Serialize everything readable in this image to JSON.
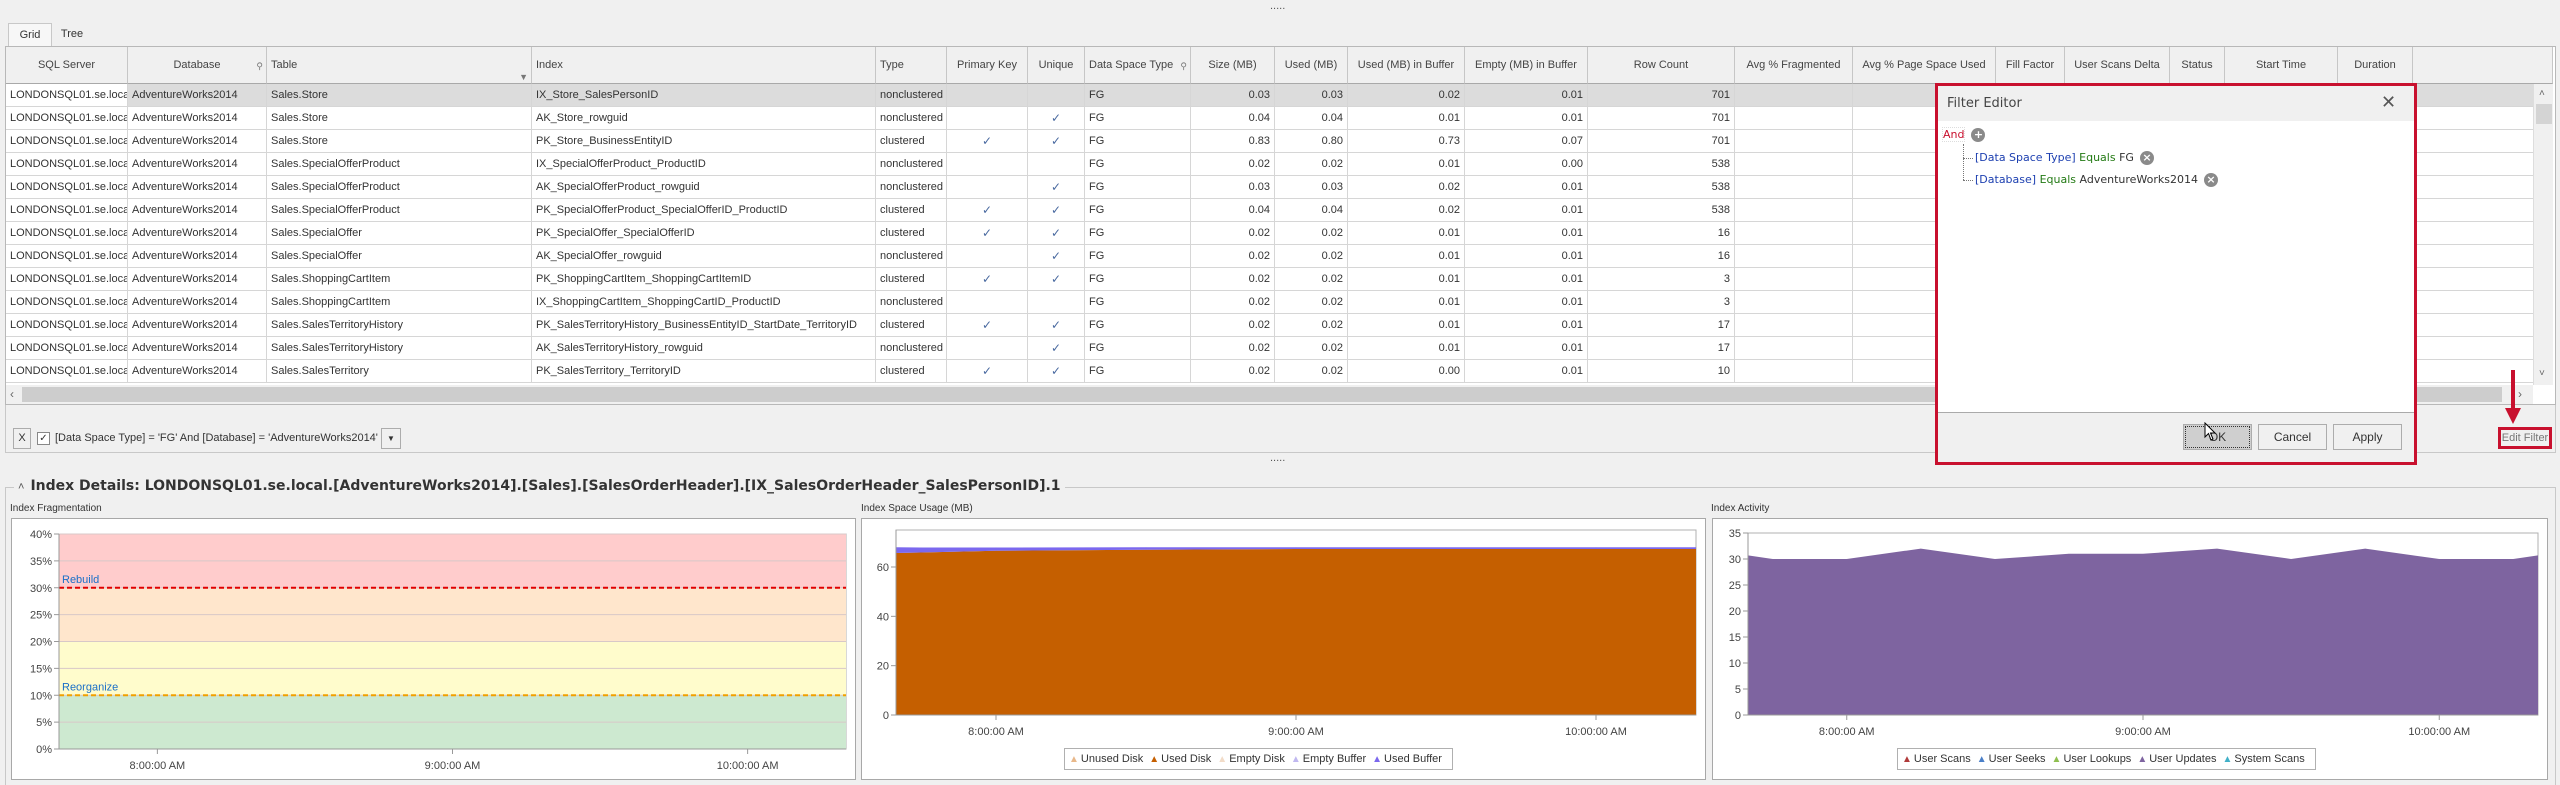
{
  "tabs": [
    {
      "label": "Grid",
      "active": true
    },
    {
      "label": "Tree",
      "active": false
    }
  ],
  "grip": ".....",
  "grid": {
    "columns": [
      "SQL Server",
      "Database",
      "Table",
      "Index",
      "Type",
      "Primary Key",
      "Unique",
      "Data Space Type",
      "Size (MB)",
      "Used (MB)",
      "Used (MB) in Buffer",
      "Empty (MB) in Buffer",
      "Row Count",
      "Avg % Fragmented",
      "Avg % Page Space Used",
      "Fill Factor",
      "User Scans Delta",
      "Status",
      "Start Time",
      "Duration"
    ],
    "filtered_columns": [
      "Database",
      "Data Space Type"
    ],
    "sorted_column": "Table",
    "check_glyph": "✓",
    "rows": [
      [
        "LONDONSQL01.se.local",
        "AdventureWorks2014",
        "Sales.Store",
        "IX_Store_SalesPersonID",
        "nonclustered",
        false,
        false,
        "FG",
        "0.03",
        "0.03",
        "0.02",
        "0.01",
        "701"
      ],
      [
        "LONDONSQL01.se.local",
        "AdventureWorks2014",
        "Sales.Store",
        "AK_Store_rowguid",
        "nonclustered",
        false,
        true,
        "FG",
        "0.04",
        "0.04",
        "0.01",
        "0.01",
        "701"
      ],
      [
        "LONDONSQL01.se.local",
        "AdventureWorks2014",
        "Sales.Store",
        "PK_Store_BusinessEntityID",
        "clustered",
        true,
        true,
        "FG",
        "0.83",
        "0.80",
        "0.73",
        "0.07",
        "701"
      ],
      [
        "LONDONSQL01.se.local",
        "AdventureWorks2014",
        "Sales.SpecialOfferProduct",
        "IX_SpecialOfferProduct_ProductID",
        "nonclustered",
        false,
        false,
        "FG",
        "0.02",
        "0.02",
        "0.01",
        "0.00",
        "538"
      ],
      [
        "LONDONSQL01.se.local",
        "AdventureWorks2014",
        "Sales.SpecialOfferProduct",
        "AK_SpecialOfferProduct_rowguid",
        "nonclustered",
        false,
        true,
        "FG",
        "0.03",
        "0.03",
        "0.02",
        "0.01",
        "538"
      ],
      [
        "LONDONSQL01.se.local",
        "AdventureWorks2014",
        "Sales.SpecialOfferProduct",
        "PK_SpecialOfferProduct_SpecialOfferID_ProductID",
        "clustered",
        true,
        true,
        "FG",
        "0.04",
        "0.04",
        "0.02",
        "0.01",
        "538"
      ],
      [
        "LONDONSQL01.se.local",
        "AdventureWorks2014",
        "Sales.SpecialOffer",
        "PK_SpecialOffer_SpecialOfferID",
        "clustered",
        true,
        true,
        "FG",
        "0.02",
        "0.02",
        "0.01",
        "0.01",
        "16"
      ],
      [
        "LONDONSQL01.se.local",
        "AdventureWorks2014",
        "Sales.SpecialOffer",
        "AK_SpecialOffer_rowguid",
        "nonclustered",
        false,
        true,
        "FG",
        "0.02",
        "0.02",
        "0.01",
        "0.01",
        "16"
      ],
      [
        "LONDONSQL01.se.local",
        "AdventureWorks2014",
        "Sales.ShoppingCartItem",
        "PK_ShoppingCartItem_ShoppingCartItemID",
        "clustered",
        true,
        true,
        "FG",
        "0.02",
        "0.02",
        "0.01",
        "0.01",
        "3"
      ],
      [
        "LONDONSQL01.se.local",
        "AdventureWorks2014",
        "Sales.ShoppingCartItem",
        "IX_ShoppingCartItem_ShoppingCartID_ProductID",
        "nonclustered",
        false,
        false,
        "FG",
        "0.02",
        "0.02",
        "0.01",
        "0.01",
        "3"
      ],
      [
        "LONDONSQL01.se.local",
        "AdventureWorks2014",
        "Sales.SalesTerritoryHistory",
        "PK_SalesTerritoryHistory_BusinessEntityID_StartDate_TerritoryID",
        "clustered",
        true,
        true,
        "FG",
        "0.02",
        "0.02",
        "0.01",
        "0.01",
        "17"
      ],
      [
        "LONDONSQL01.se.local",
        "AdventureWorks2014",
        "Sales.SalesTerritoryHistory",
        "AK_SalesTerritoryHistory_rowguid",
        "nonclustered",
        false,
        true,
        "FG",
        "0.02",
        "0.02",
        "0.01",
        "0.01",
        "17"
      ],
      [
        "LONDONSQL01.se.local",
        "AdventureWorks2014",
        "Sales.SalesTerritory",
        "PK_SalesTerritory_TerritoryID",
        "clustered",
        true,
        true,
        "FG",
        "0.02",
        "0.02",
        "0.00",
        "0.01",
        "10"
      ]
    ]
  },
  "filter_bar": {
    "clear_label": "X",
    "enabled": true,
    "expression": "[Data Space Type] = 'FG' And [Database] = 'AdventureWorks2014'",
    "edit_filter_label": "Edit Filter"
  },
  "filter_editor": {
    "title": "Filter Editor",
    "group_operator": "And",
    "conditions": [
      {
        "field": "[Data Space Type]",
        "operator": "Equals",
        "value": "FG"
      },
      {
        "field": "[Database]",
        "operator": "Equals",
        "value": "AdventureWorks2014"
      }
    ],
    "ok_label": "OK",
    "cancel_label": "Cancel",
    "apply_label": "Apply"
  },
  "details": {
    "title": "Index Details: LONDONSQL01.se.local.[AdventureWorks2014].[Sales].[SalesOrderHeader].[IX_SalesOrderHeader_SalesPersonID].1"
  },
  "colors": {
    "highlight": "#c8102e",
    "used_disk": "#c55f00",
    "used_buffer": "#7b68ee",
    "user_updates": "#7e64a0"
  },
  "chart_data": [
    {
      "type": "area",
      "title": "Index Fragmentation",
      "x_ticks": [
        "8:00:00 AM",
        "9:00:00 AM",
        "10:00:00 AM"
      ],
      "xlim": [
        "7:40",
        "10:20"
      ],
      "ylim": [
        0,
        40
      ],
      "y_ticks": [
        "0%",
        "5%",
        "10%",
        "15%",
        "20%",
        "25%",
        "30%",
        "35%",
        "40%"
      ],
      "bands": [
        {
          "from": 0,
          "to": 10,
          "color": "#cde9d0"
        },
        {
          "from": 10,
          "to": 20,
          "color": "#fffccc"
        },
        {
          "from": 20,
          "to": 30,
          "color": "#ffe6cc"
        },
        {
          "from": 30,
          "to": 40,
          "color": "#ffcccc"
        }
      ],
      "thresholds": [
        {
          "label": "Rebuild",
          "value": 30,
          "color": "#e00000"
        },
        {
          "label": "Reorganize",
          "value": 10,
          "color": "#f0a000"
        }
      ],
      "series": []
    },
    {
      "type": "area",
      "title": "Index Space Usage (MB)",
      "x_ticks": [
        "8:00:00 AM",
        "9:00:00 AM",
        "10:00:00 AM"
      ],
      "xlim": [
        "7:40",
        "10:20"
      ],
      "ylim": [
        0,
        75
      ],
      "y_ticks": [
        "0",
        "20",
        "40",
        "60"
      ],
      "stacked": true,
      "legend": [
        {
          "name": "Unused Disk",
          "color": "#e8b88a"
        },
        {
          "name": "Used Disk",
          "color": "#c55f00"
        },
        {
          "name": "Empty Disk",
          "color": "#f2dcc8"
        },
        {
          "name": "Empty Buffer",
          "color": "#c0b8f0"
        },
        {
          "name": "Used Buffer",
          "color": "#7b68ee"
        }
      ],
      "series": [
        {
          "name": "Used Disk",
          "color": "#c55f00",
          "x": [
            "7:40",
            "7:45",
            "8:00",
            "8:30",
            "9:00",
            "9:30",
            "10:00",
            "10:20"
          ],
          "y": [
            65.7,
            65.9,
            66.6,
            67.0,
            67.3,
            67.3,
            67.3,
            67.3
          ]
        },
        {
          "name": "Used Buffer",
          "color": "#7b68ee",
          "x": [
            "7:40",
            "7:45",
            "8:00",
            "8:30",
            "9:00",
            "9:30",
            "10:00",
            "10:20"
          ],
          "y": [
            2.3,
            2.0,
            1.3,
            1.0,
            0.7,
            0.7,
            0.7,
            0.7
          ]
        }
      ]
    },
    {
      "type": "area",
      "title": "Index Activity",
      "x_ticks": [
        "8:00:00 AM",
        "9:00:00 AM",
        "10:00:00 AM"
      ],
      "xlim": [
        "7:40",
        "10:20"
      ],
      "ylim": [
        0,
        35
      ],
      "y_ticks": [
        "0",
        "5",
        "10",
        "15",
        "20",
        "25",
        "30",
        "35"
      ],
      "legend": [
        {
          "name": "User Scans",
          "color": "#b03a3a"
        },
        {
          "name": "User Seeks",
          "color": "#4a7fc8"
        },
        {
          "name": "User Lookups",
          "color": "#8fbf50"
        },
        {
          "name": "User Updates",
          "color": "#7e64a0"
        },
        {
          "name": "System Scans",
          "color": "#40b0c8"
        }
      ],
      "series": [
        {
          "name": "User Updates",
          "color": "#7e64a0",
          "x": [
            "7:40",
            "7:45",
            "8:00",
            "8:15",
            "8:30",
            "8:45",
            "9:00",
            "9:15",
            "9:30",
            "9:45",
            "10:00",
            "10:15",
            "10:20"
          ],
          "y": [
            30.7,
            30,
            30,
            32,
            30,
            31,
            31,
            32,
            30,
            32,
            30,
            30,
            30.7
          ]
        }
      ]
    }
  ]
}
